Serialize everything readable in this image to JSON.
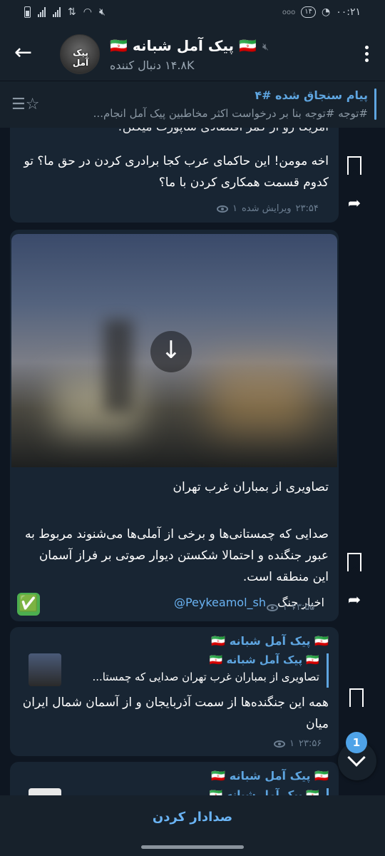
{
  "status_bar": {
    "time": "۰۰:۲۱",
    "notif_count": "۱۴",
    "carrier": "ooo"
  },
  "header": {
    "back_label": "←",
    "avatar_text": "پیک آمل",
    "title": "🇮🇷 پیک آمل شبانه 🇮🇷",
    "subscribers": "۱۴.۸K دنبال کننده"
  },
  "pinned": {
    "title": "پیام سنجاق شده #۴",
    "text": "#توجه #توجه   بنا بر درخواست اکثر مخاطبین پیک آمل انجام..."
  },
  "messages": [
    {
      "text_top": "آمریکا رو از کمر اقتصادی ساپورت میکنن!",
      "text": "اخه مومن! این حاکمای عرب کجا برادری کردن در حق ما؟ تو کدوم قسمت همکاری کردن با ما؟",
      "views": "۱",
      "edited": "ویرایش شده",
      "time": "۲۳:۵۴"
    },
    {
      "caption_title": "تصاویری از بمباران غرب تهران",
      "caption_body": "صدایی که چمستانی‌ها و برخی از آملی‌ها می‌شنوند مربوط به عبور جنگنده و احتمالا شکستن دیوار صوتی بر فراز آسمان این منطقه است.",
      "footer_label": "اخبار جنگ",
      "footer_link": "@Peykeamol_sh",
      "check": "✅",
      "views": "۱",
      "time": "۲۳:۵۵"
    },
    {
      "author": "🇮🇷 پیک آمل شبانه 🇮🇷",
      "reply_author": "🇮🇷 پیک آمل شبانه 🇮🇷",
      "reply_text": "تصاویری از بمباران غرب تهران  صدایی که چمستا...",
      "text": "همه این جنگنده‌ها از سمت آذربایجان و از آسمان شمال ایران میان",
      "views": "۱",
      "time": "۲۳:۵۶"
    },
    {
      "author": "🇮🇷 پیک آمل شبانه 🇮🇷",
      "reply_author": "🇮🇷 پیک آمل شبانه 🇮🇷"
    }
  ],
  "scroll_badge": "1",
  "bottom": {
    "unmute_label": "صدادار کردن"
  }
}
